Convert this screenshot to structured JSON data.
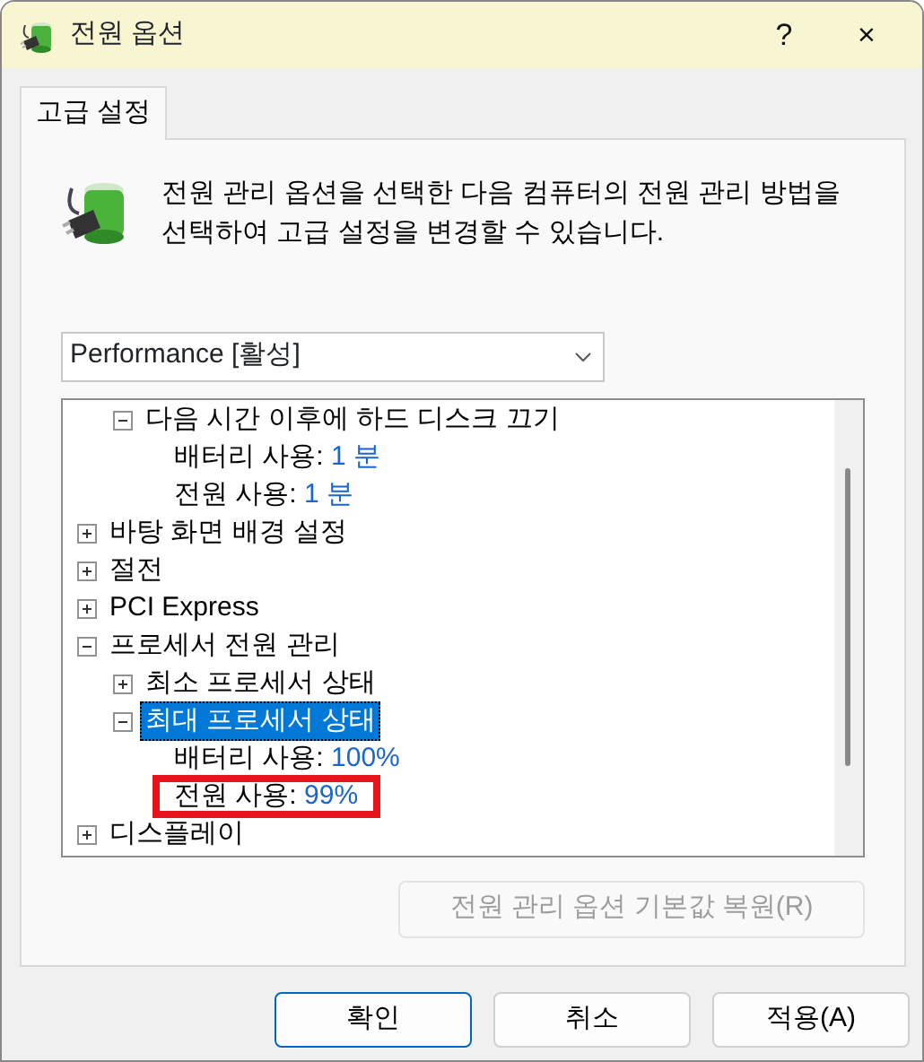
{
  "window": {
    "title": "전원 옵션",
    "help": "?",
    "close": "×"
  },
  "tabs": [
    {
      "label": "고급 설정",
      "selected": true
    }
  ],
  "description": "전원 관리 옵션을 선택한 다음 컴퓨터의 전원 관리 방법을 선택하여 고급 설정을 변경할 수 있습니다.",
  "plan_dropdown": {
    "value": "Performance [활성]"
  },
  "tree": {
    "continued_children": [
      {
        "label": "다음 시간 이후에 하드 디스크 끄기",
        "expanded": true,
        "selected": false,
        "children": [
          {
            "label": "배터리 사용:",
            "value": "1 분",
            "highlighted": false
          },
          {
            "label": "전원 사용:",
            "value": "1 분",
            "highlighted": false
          }
        ]
      }
    ],
    "items": [
      {
        "label": "바탕 화면 배경 설정",
        "expanded": false,
        "selected": false
      },
      {
        "label": "절전",
        "expanded": false,
        "selected": false
      },
      {
        "label": "PCI Express",
        "expanded": false,
        "selected": false
      },
      {
        "label": "프로세서 전원 관리",
        "expanded": true,
        "selected": false,
        "children": [
          {
            "label": "최소 프로세서 상태",
            "expanded": false,
            "selected": false
          },
          {
            "label": "최대 프로세서 상태",
            "expanded": true,
            "selected": true,
            "children": [
              {
                "label": "배터리 사용:",
                "value": "100%",
                "highlighted": false
              },
              {
                "label": "전원 사용:",
                "value": "99%",
                "highlighted": true
              }
            ]
          }
        ]
      },
      {
        "label": "디스플레이",
        "expanded": false,
        "selected": false
      }
    ]
  },
  "restore_button": {
    "label": "전원 관리 옵션 기본값 복원(R)",
    "disabled": true
  },
  "buttons": [
    {
      "label": "확인",
      "default": true
    },
    {
      "label": "취소",
      "default": false
    },
    {
      "label": "적용(A)",
      "default": false
    }
  ]
}
